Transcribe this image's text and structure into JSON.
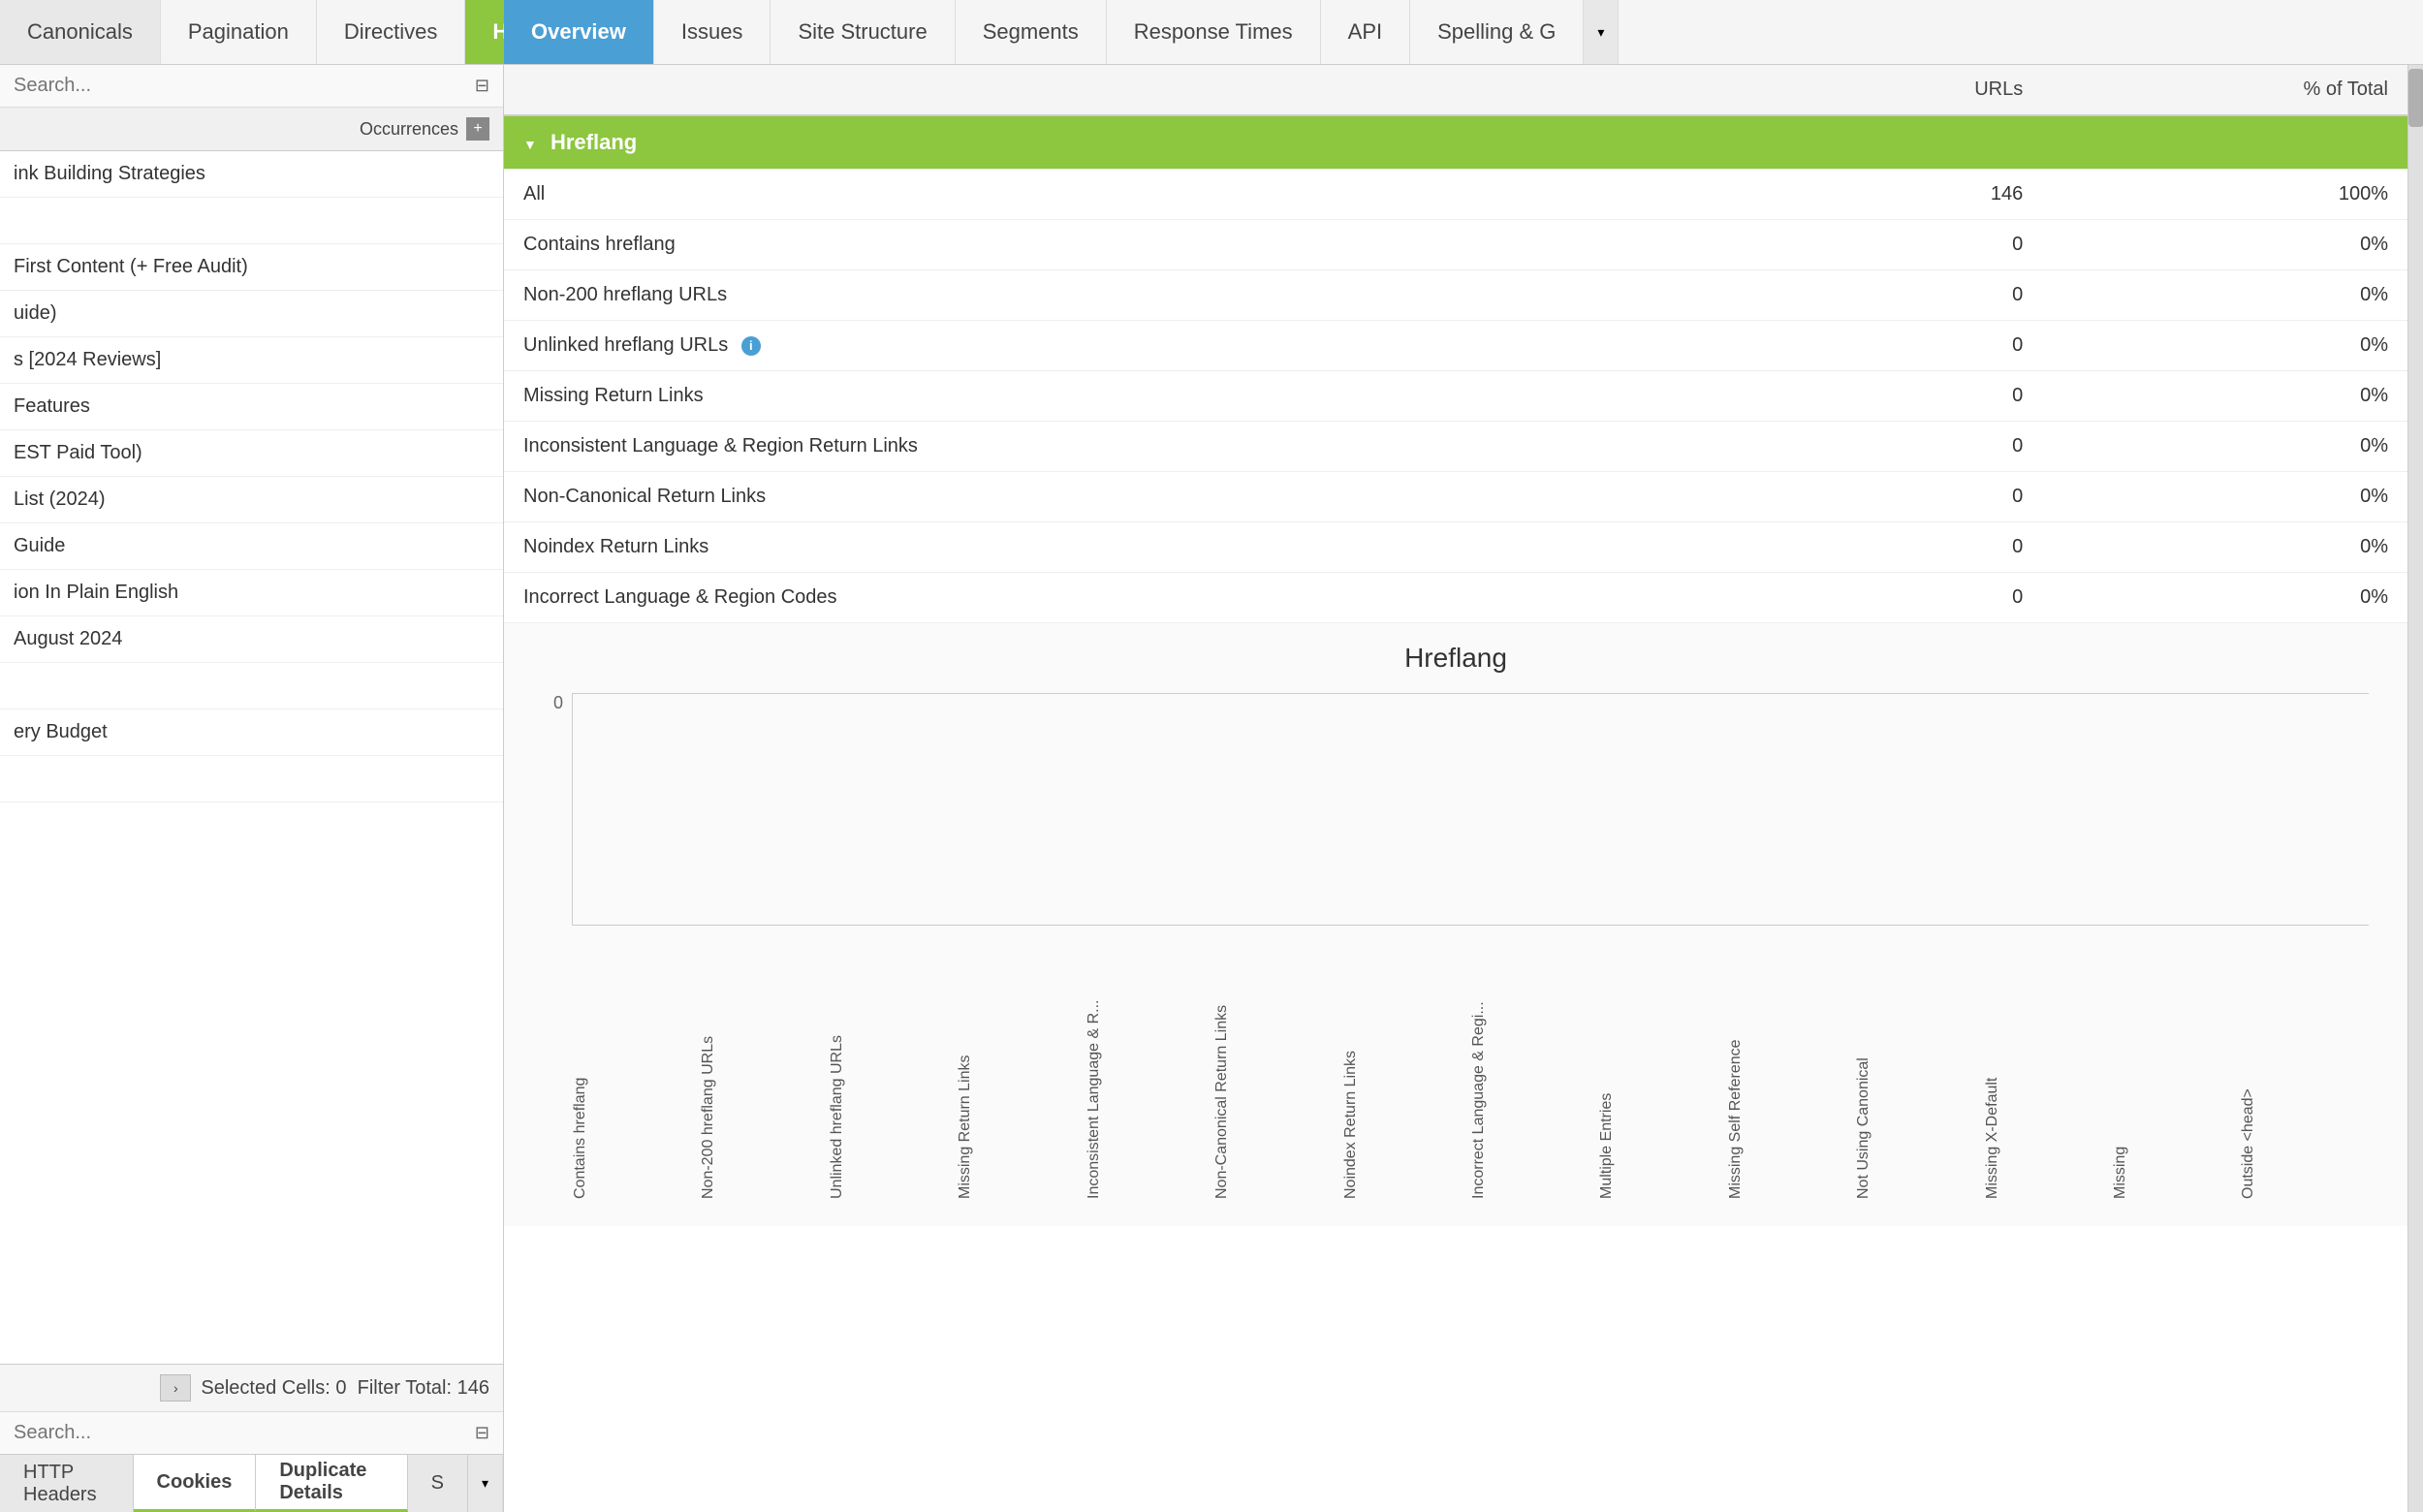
{
  "topNav": {
    "leftTabs": [
      {
        "id": "canonicals",
        "label": "Canonicals",
        "active": false
      },
      {
        "id": "pagination",
        "label": "Pagination",
        "active": false
      },
      {
        "id": "directives",
        "label": "Directives",
        "active": false
      },
      {
        "id": "hreflang",
        "label": "Hreflang",
        "active": true
      },
      {
        "id": "more-left",
        "label": "▾",
        "dropdown": true
      }
    ],
    "rightTabs": [
      {
        "id": "overview",
        "label": "Overview",
        "active": true
      },
      {
        "id": "issues",
        "label": "Issues",
        "active": false
      },
      {
        "id": "site-structure",
        "label": "Site Structure",
        "active": false
      },
      {
        "id": "segments",
        "label": "Segments",
        "active": false
      },
      {
        "id": "response-times",
        "label": "Response Times",
        "active": false
      },
      {
        "id": "api",
        "label": "API",
        "active": false
      },
      {
        "id": "spelling",
        "label": "Spelling & G",
        "active": false
      },
      {
        "id": "more-right",
        "label": "▾",
        "dropdown": true
      }
    ]
  },
  "leftPanel": {
    "searchPlaceholder": "Search...",
    "columns": {
      "name": "",
      "occurrences": "Occurrences"
    },
    "listItems": [
      {
        "text": "ink Building Strategies",
        "value": ""
      },
      {
        "text": "",
        "value": ""
      },
      {
        "text": "First Content (+ Free Audit)",
        "value": ""
      },
      {
        "text": "uide)",
        "value": ""
      },
      {
        "text": "s [2024 Reviews]",
        "value": ""
      },
      {
        "text": "Features",
        "value": ""
      },
      {
        "text": "EST Paid Tool)",
        "value": ""
      },
      {
        "text": "List (2024)",
        "value": ""
      },
      {
        "text": "Guide",
        "value": ""
      },
      {
        "text": "ion In Plain English",
        "value": ""
      },
      {
        "text": "August 2024",
        "value": ""
      },
      {
        "text": "",
        "value": ""
      },
      {
        "text": "ery Budget",
        "value": ""
      },
      {
        "text": "",
        "value": ""
      }
    ],
    "footer": {
      "selectedCells": "Selected Cells:",
      "selectedCount": "0",
      "filterTotal": "Filter Total:",
      "filterCount": "146"
    },
    "bottomSearch": {
      "placeholder": "Search..."
    }
  },
  "bottomTabs": [
    {
      "id": "http-headers",
      "label": "HTTP Headers",
      "active": false
    },
    {
      "id": "cookies",
      "label": "Cookies",
      "active": true
    },
    {
      "id": "duplicate-details",
      "label": "Duplicate Details",
      "active": true
    },
    {
      "id": "s",
      "label": "S",
      "active": false
    },
    {
      "id": "more",
      "label": "▾",
      "dropdown": true
    }
  ],
  "rightPanel": {
    "tableHeaders": {
      "name": "",
      "urls": "URLs",
      "percentOfTotal": "% of Total"
    },
    "sectionHeader": {
      "label": "Hreflang",
      "collapseIcon": "▼"
    },
    "rows": [
      {
        "name": "All",
        "urls": "146",
        "percent": "100%"
      },
      {
        "name": "Contains hreflang",
        "urls": "0",
        "percent": "0%"
      },
      {
        "name": "Non-200 hreflang URLs",
        "urls": "0",
        "percent": "0%"
      },
      {
        "name": "Unlinked hreflang URLs",
        "urls": "0",
        "percent": "0%",
        "hasInfo": true
      },
      {
        "name": "Missing Return Links",
        "urls": "0",
        "percent": "0%"
      },
      {
        "name": "Inconsistent Language & Region Return Links",
        "urls": "0",
        "percent": "0%"
      },
      {
        "name": "Non-Canonical Return Links",
        "urls": "0",
        "percent": "0%"
      },
      {
        "name": "Noindex Return Links",
        "urls": "0",
        "percent": "0%"
      },
      {
        "name": "Incorrect Language & Region Codes",
        "urls": "0",
        "percent": "0%"
      }
    ],
    "chart": {
      "title": "Hreflang",
      "zeroLabel": "0",
      "xLabels": [
        "Contains hreflang",
        "Non-200 hreflang URLs",
        "Unlinked hreflang URLs",
        "Missing Return Links",
        "Inconsistent Language & R...",
        "Non-Canonical Return Links",
        "Noindex Return Links",
        "Incorrect Language & Regi...",
        "Multiple Entries",
        "Missing Self Reference",
        "Not Using Canonical",
        "Missing X-Default",
        "Missing",
        "Outside <head>"
      ]
    }
  }
}
